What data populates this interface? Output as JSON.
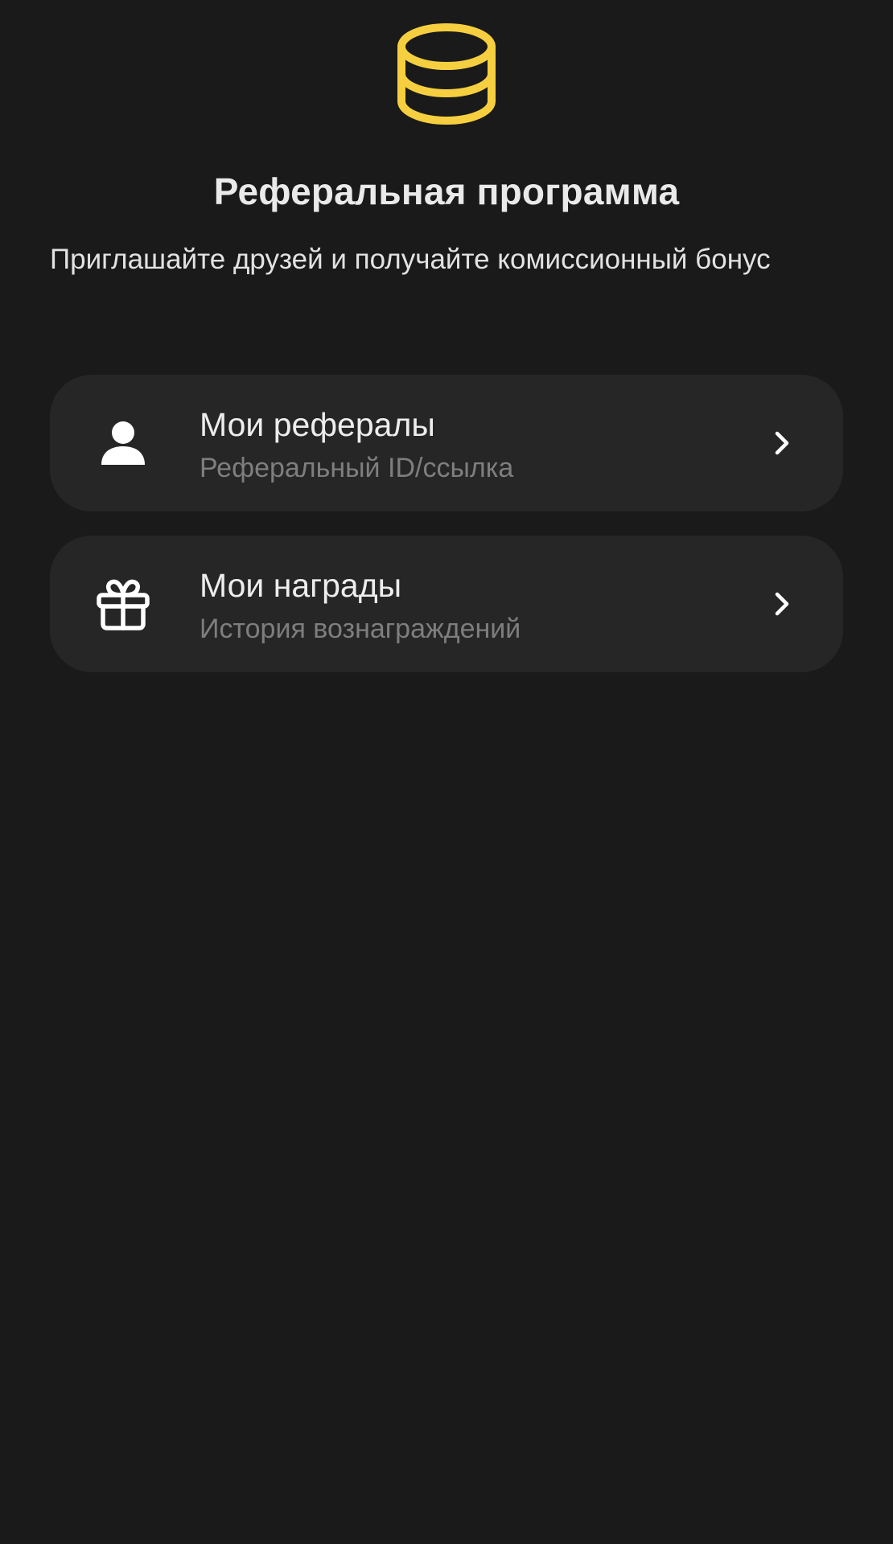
{
  "header": {
    "icon": "coins-stack-icon",
    "title": "Реферальная программа",
    "subtitle": "Приглашайте друзей и получайте комиссионный бонус"
  },
  "menu": {
    "items": [
      {
        "icon": "user-icon",
        "title": "Мои рефералы",
        "subtitle": "Реферальный ID/ссылка"
      },
      {
        "icon": "gift-icon",
        "title": "Мои награды",
        "subtitle": "История вознаграждений"
      }
    ]
  },
  "colors": {
    "background": "#1a1a1a",
    "card": "#262626",
    "accent": "#f5cf3f",
    "text_primary": "#ededed",
    "text_secondary": "#7e7e7e"
  }
}
